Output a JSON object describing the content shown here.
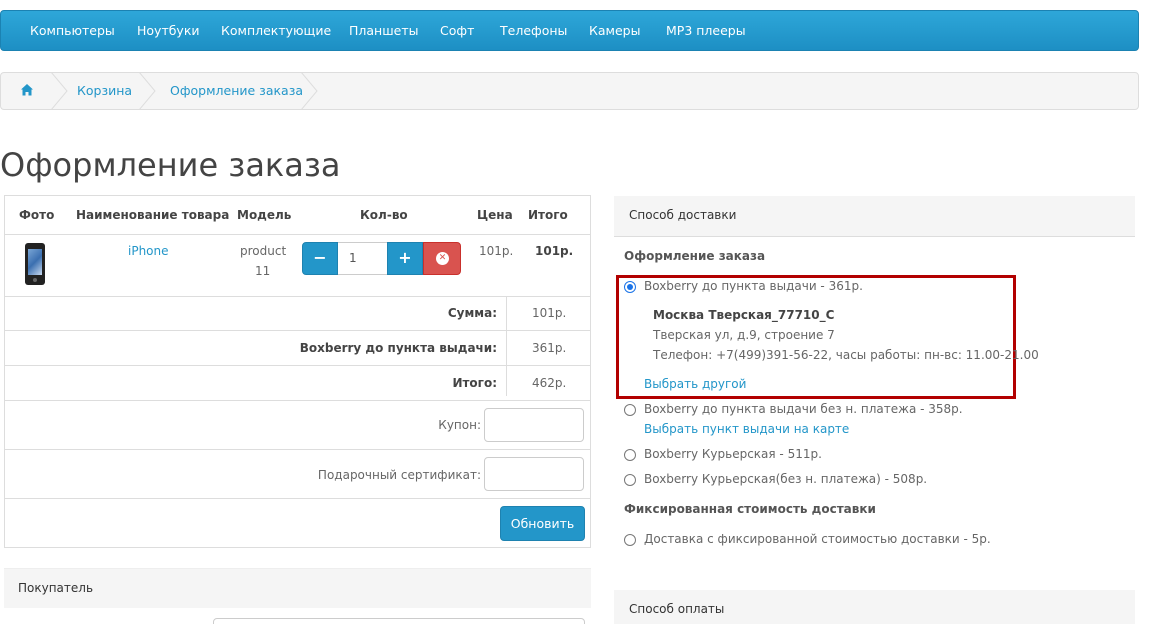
{
  "nav": {
    "items": [
      "Компьютеры",
      "Ноутбуки",
      "Комплектующие",
      "Планшеты",
      "Софт",
      "Телефоны",
      "Камеры",
      "MP3 плееры"
    ]
  },
  "breadcrumb": {
    "home_icon": "home-icon",
    "items": [
      "Корзина",
      "Оформление заказа"
    ]
  },
  "page_title": "Оформление заказа",
  "cart": {
    "headers": {
      "photo": "Фото",
      "name": "Наименование товара",
      "model": "Модель",
      "qty": "Кол-во",
      "price": "Цена",
      "total": "Итого"
    },
    "item": {
      "name": "iPhone",
      "model_line1": "product",
      "model_line2": "11",
      "qty": "1",
      "price": "101р.",
      "total": "101р.",
      "minus": "−",
      "plus": "+",
      "remove": "✕"
    },
    "summary": {
      "sum_label": "Сумма:",
      "sum_value": "101р.",
      "ship_label": "Boxberry до пункта выдачи:",
      "ship_value": "361р.",
      "total_label": "Итого:",
      "total_value": "462р."
    },
    "coupon_label": "Купон:",
    "gift_label": "Подарочный сертификат:",
    "update_button": "Обновить"
  },
  "buyer": {
    "title": "Покупатель"
  },
  "shipping": {
    "title": "Способ доставки",
    "group1_title": "Оформление заказа",
    "options": [
      {
        "label": "Boxberry до пункта выдачи - 361р.",
        "selected": true
      },
      {
        "label": "Boxberry до пункта выдачи без н. платежа - 358р.",
        "selected": false
      },
      {
        "label": "Boxberry Курьерская - 511р.",
        "selected": false
      },
      {
        "label": "Boxberry Курьерская(без н. платежа) - 508р.",
        "selected": false
      }
    ],
    "point": {
      "name": "Москва Тверская_77710_С",
      "address": "Тверская ул, д.9, строение 7",
      "phone": "Телефон: +7(499)391-56-22, часы работы: пн-вс: 11.00-21.00",
      "change_link": "Выбрать другой"
    },
    "map_link": "Выбрать пункт выдачи на карте",
    "group2_title": "Фиксированная стоимость доставки",
    "fixed_option": "Доставка с фиксированной стоимостью доставки - 5р."
  },
  "payment": {
    "title": "Способ оплаты"
  },
  "colors": {
    "accent": "#2396c9",
    "highlight_border": "#b20000",
    "remove_button": "#d9534f"
  }
}
